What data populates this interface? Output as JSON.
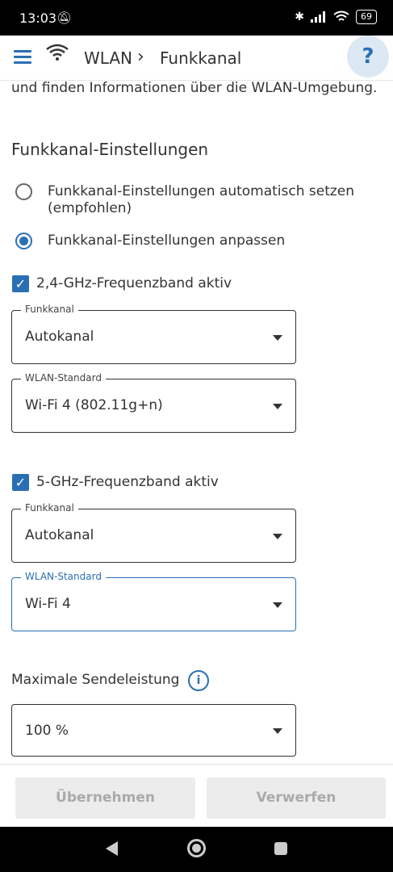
{
  "status_bar": {
    "time": "13:03",
    "battery": "69"
  },
  "app_bar": {
    "crumb_root": "WLAN",
    "crumb_current": "Funkkanal",
    "help_label": "?"
  },
  "intro_text": "und finden Informationen über die WLAN-Umgebung.",
  "section_title": "Funkkanal-Einstellungen",
  "radios": [
    {
      "label": "Funkkanal-Einstellungen automatisch setzen (empfohlen)",
      "selected": false
    },
    {
      "label": "Funkkanal-Einstellungen anpassen",
      "selected": true
    }
  ],
  "band_24": {
    "label": "2,4-GHz-Frequenzband aktiv",
    "checked": true,
    "channel": {
      "legend": "Funkkanal",
      "value": "Autokanal"
    },
    "standard": {
      "legend": "WLAN-Standard",
      "value": "Wi-Fi 4 (802.11g+n)"
    }
  },
  "band_5": {
    "label": "5-GHz-Frequenzband aktiv",
    "checked": true,
    "channel": {
      "legend": "Funkkanal",
      "value": "Autokanal"
    },
    "standard": {
      "legend": "WLAN-Standard",
      "value": "Wi-Fi 4"
    }
  },
  "power": {
    "label": "Maximale Sendeleistung",
    "value": "100 %"
  },
  "actions": {
    "apply": "Übernehmen",
    "discard": "Verwerfen"
  },
  "colors": {
    "accent": "#2a6fb3",
    "help_bg": "#dce9f4"
  }
}
